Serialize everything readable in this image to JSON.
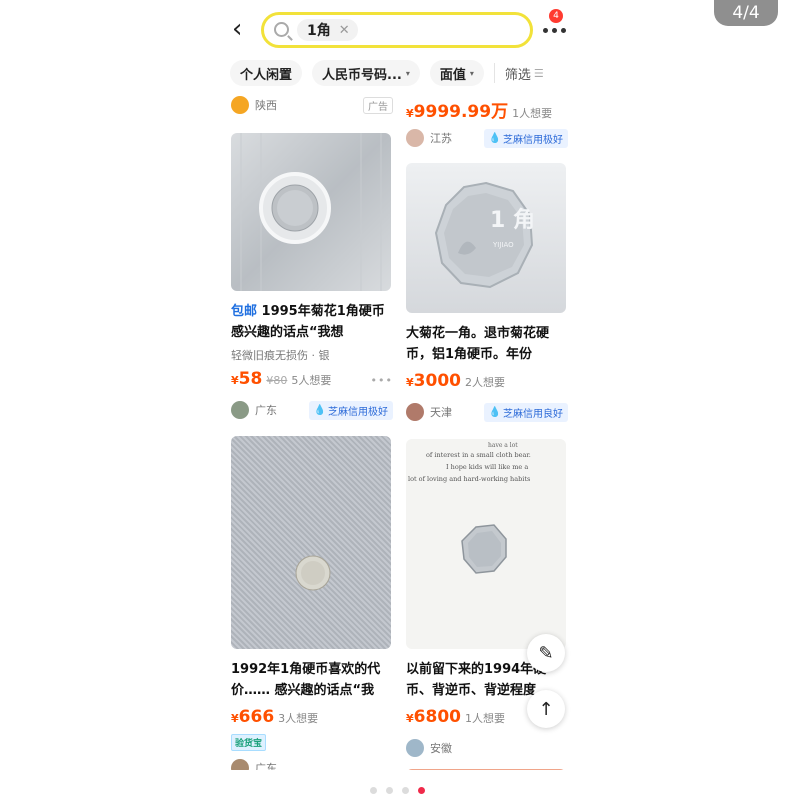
{
  "gallery": {
    "counter": "4/4",
    "pages": 4,
    "active_page": 4
  },
  "search": {
    "query_chip": "1角",
    "clear_icon": "close-icon"
  },
  "header": {
    "message_badge": "4"
  },
  "filters": [
    {
      "label": "个人闲置"
    },
    {
      "label": "人民币号码..."
    },
    {
      "label": "面值"
    },
    {
      "label": "筛选"
    }
  ],
  "left": {
    "top_seller": {
      "location": "陕西",
      "ad": "广告"
    },
    "items": [
      {
        "tag": "包邮",
        "title": "1995年菊花1角硬币 感兴趣的话点“我想",
        "desc": "轻微旧痕无损伤 · 银",
        "price": "58",
        "orig": "¥80",
        "want": "5人想要",
        "location": "广东",
        "credit": "芝麻信用极好"
      },
      {
        "title": "1992年1角硬币喜欢的代价…… 感兴趣的话点“我",
        "price": "666",
        "want": "3人想要",
        "badge": "验货宝",
        "location": "广东"
      }
    ]
  },
  "right": {
    "top_item": {
      "price": "9999.99万",
      "want": "1人想要",
      "location": "江苏",
      "credit": "芝麻信用极好"
    },
    "items": [
      {
        "title": "大菊花一角。退市菊花硬币，铝1角硬币。年份",
        "price": "3000",
        "want": "2人想要",
        "location": "天津",
        "credit": "芝麻信用良好",
        "coin_text": "1 角",
        "coin_sub": "YIJIAO"
      },
      {
        "title": "以前留下来的1994年硬币、背逆币、背逆程度",
        "price": "6800",
        "want": "1人想要",
        "location": "安徽",
        "paper_lines": [
          "have a lot",
          "of interest in a small cloth bear.",
          "I hope kids will like me a",
          "lot of loving and hard-working habits"
        ]
      }
    ]
  },
  "currency": "¥",
  "colors": {
    "accent": "#ff5000",
    "search_border": "#f2e23a",
    "active_dot": "#f02a4a"
  }
}
